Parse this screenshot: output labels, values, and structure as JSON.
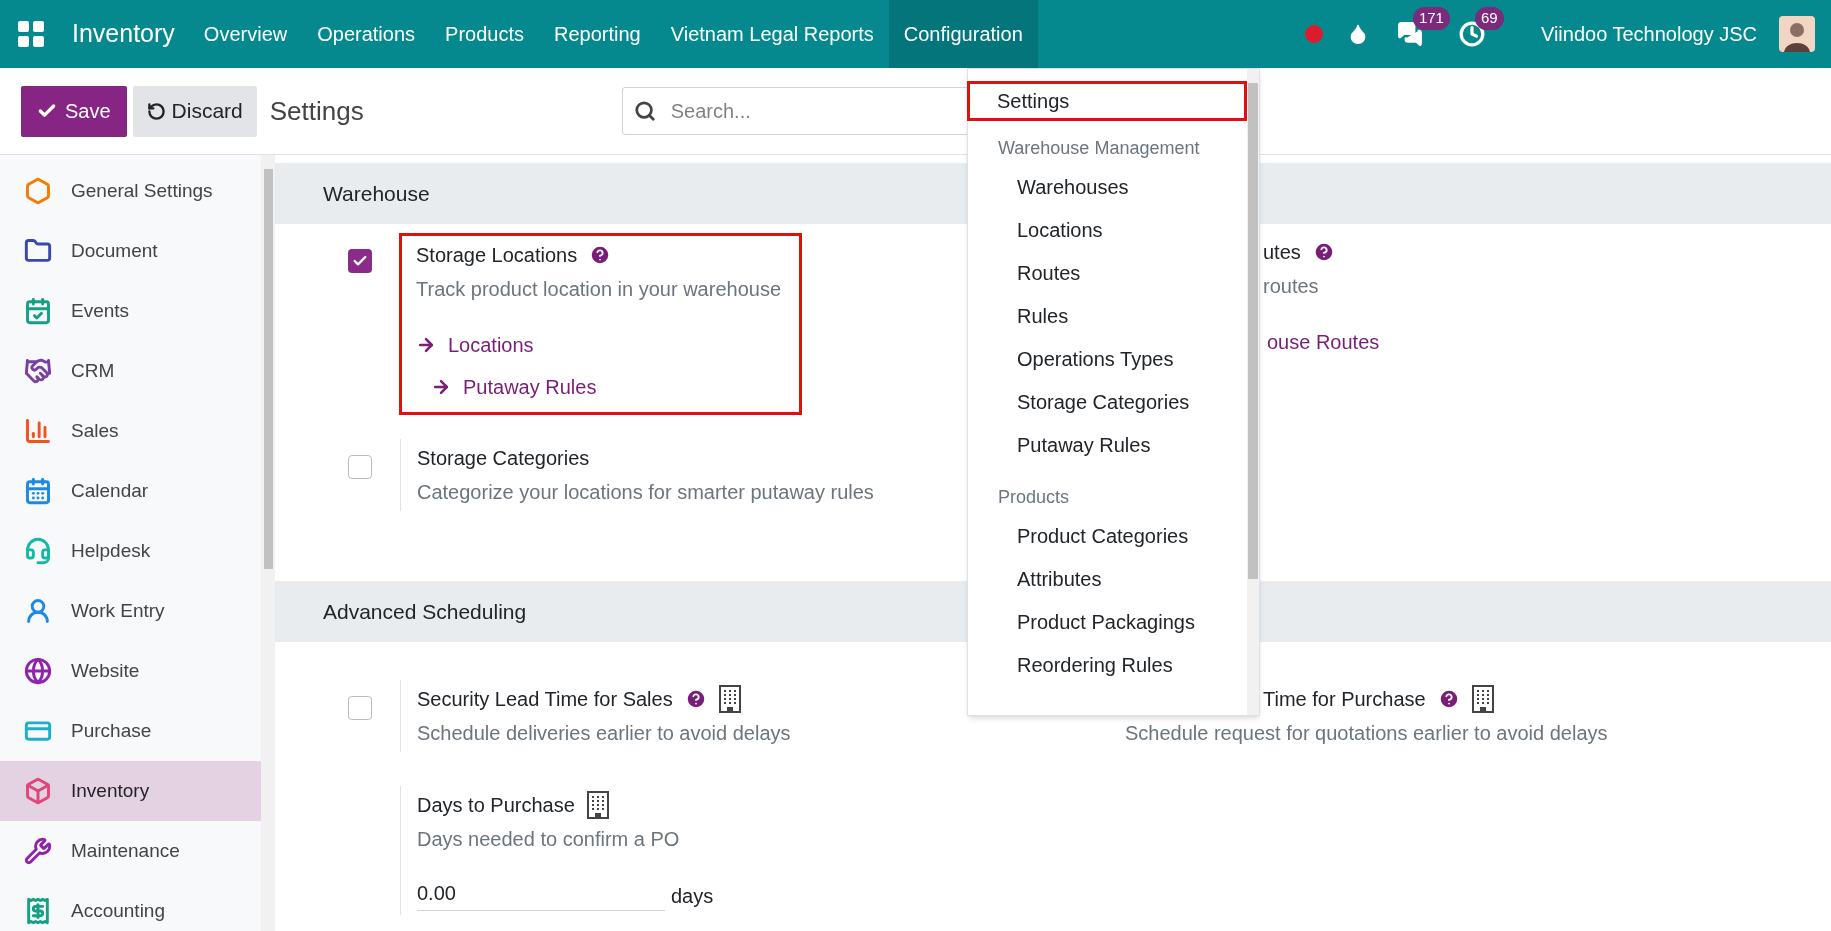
{
  "topbar": {
    "app": "Inventory",
    "menu": [
      {
        "label": "Overview",
        "selected": false
      },
      {
        "label": "Operations",
        "selected": false
      },
      {
        "label": "Products",
        "selected": false
      },
      {
        "label": "Reporting",
        "selected": false
      },
      {
        "label": "Vietnam Legal Reports",
        "selected": false
      },
      {
        "label": "Configuration",
        "selected": true
      }
    ],
    "messages_count": "171",
    "activities_count": "69",
    "company": "Viindoo Technology JSC"
  },
  "control_panel": {
    "save": "Save",
    "discard": "Discard",
    "title": "Settings",
    "search_placeholder": "Search..."
  },
  "sidebar": {
    "items": [
      {
        "label": "General Settings",
        "selected": false
      },
      {
        "label": "Document",
        "selected": false
      },
      {
        "label": "Events",
        "selected": false
      },
      {
        "label": "CRM",
        "selected": false
      },
      {
        "label": "Sales",
        "selected": false
      },
      {
        "label": "Calendar",
        "selected": false
      },
      {
        "label": "Helpdesk",
        "selected": false
      },
      {
        "label": "Work Entry",
        "selected": false
      },
      {
        "label": "Website",
        "selected": false
      },
      {
        "label": "Purchase",
        "selected": false
      },
      {
        "label": "Inventory",
        "selected": true
      },
      {
        "label": "Maintenance",
        "selected": false
      },
      {
        "label": "Accounting",
        "selected": false
      }
    ]
  },
  "sections": [
    {
      "title": "Warehouse",
      "rows": [
        {
          "left": {
            "title": "Storage Locations",
            "help": true,
            "checked": true,
            "highlighted": true,
            "description": "Track product location in your warehouse",
            "links": [
              "Locations",
              "Putaway Rules"
            ]
          },
          "right": {
            "title": "utes",
            "help": true,
            "description": "routes",
            "links": [
              "ouse Routes"
            ]
          }
        },
        {
          "left": {
            "title": "Storage Categories",
            "checked": false,
            "highlighted": false,
            "description": "Categorize your locations for smarter putaway rules"
          }
        }
      ]
    },
    {
      "title": "Advanced Scheduling",
      "rows": [
        {
          "left": {
            "title": "Security Lead Time for Sales",
            "help": true,
            "company": true,
            "checked": false,
            "highlighted": false,
            "description": "Schedule deliveries earlier to avoid delays"
          },
          "right": {
            "title": "Time for Purchase",
            "help": true,
            "company": true,
            "description": "Schedule request for quotations earlier to avoid delays"
          }
        },
        {
          "left": {
            "title": "Days to Purchase",
            "company": true,
            "highlighted": false,
            "description": "Days needed to confirm a PO",
            "input": {
              "value": "0.00",
              "unit": "days"
            }
          }
        }
      ]
    }
  ],
  "config_menu": {
    "items": [
      {
        "kind": "item",
        "label": "Settings",
        "highlighted": true
      },
      {
        "kind": "header",
        "label": "Warehouse Management"
      },
      {
        "kind": "subitem",
        "label": "Warehouses"
      },
      {
        "kind": "subitem",
        "label": "Locations"
      },
      {
        "kind": "subitem",
        "label": "Routes"
      },
      {
        "kind": "subitem",
        "label": "Rules"
      },
      {
        "kind": "subitem",
        "label": "Operations Types"
      },
      {
        "kind": "subitem",
        "label": "Storage Categories"
      },
      {
        "kind": "subitem",
        "label": "Putaway Rules"
      },
      {
        "kind": "header",
        "label": "Products"
      },
      {
        "kind": "subitem",
        "label": "Product Categories"
      },
      {
        "kind": "subitem",
        "label": "Attributes"
      },
      {
        "kind": "subitem",
        "label": "Product Packagings"
      },
      {
        "kind": "subitem",
        "label": "Reordering Rules"
      }
    ]
  }
}
